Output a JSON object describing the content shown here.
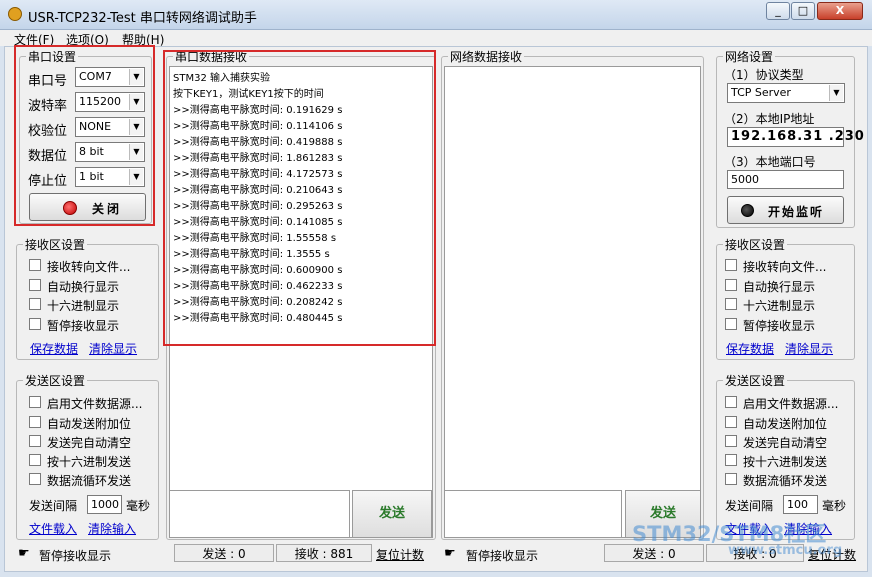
{
  "window": {
    "title": "USR-TCP232-Test 串口转网络调试助手",
    "min": "_",
    "max": "□",
    "close": "X"
  },
  "menu": [
    "文件(F)",
    "选项(O)",
    "帮助(H)"
  ],
  "serial_settings": {
    "title": "串口设置",
    "fields": [
      {
        "label": "串口号",
        "value": "COM7"
      },
      {
        "label": "波特率",
        "value": "115200"
      },
      {
        "label": "校验位",
        "value": "NONE"
      },
      {
        "label": "数据位",
        "value": "8 bit"
      },
      {
        "label": "停止位",
        "value": "1 bit"
      }
    ],
    "close_button": "关闭"
  },
  "serial_receive": {
    "title": "串口数据接收",
    "lines": [
      "STM32 输入捕获实验",
      "按下KEY1，测试KEY1按下的时间",
      ">>测得高电平脉宽时间: 0.191629 s",
      ">>测得高电平脉宽时间: 0.114106 s",
      ">>测得高电平脉宽时间: 0.419888 s",
      ">>测得高电平脉宽时间: 1.861283 s",
      ">>测得高电平脉宽时间: 4.172573 s",
      ">>测得高电平脉宽时间: 0.210643 s",
      ">>测得高电平脉宽时间: 0.295263 s",
      ">>测得高电平脉宽时间: 0.141085 s",
      ">>测得高电平脉宽时间: 1.55558 s",
      ">>测得高电平脉宽时间: 1.3555 s",
      ">>测得高电平脉宽时间: 0.600900 s",
      ">>测得高电平脉宽时间: 0.462233 s",
      ">>测得高电平脉宽时间: 0.208242 s",
      ">>测得高电平脉宽时间: 0.480445 s"
    ]
  },
  "network_receive": {
    "title": "网络数据接收"
  },
  "network_settings": {
    "title": "网络设置",
    "protocol_label": "（1）协议类型",
    "protocol_value": "TCP Server",
    "ip_label": "（2）本地IP地址",
    "ip_value": "192.168.31 .230",
    "port_label": "（3）本地端口号",
    "port_value": "5000",
    "listen_button": "开始监听"
  },
  "left_receive": {
    "title": "接收区设置",
    "options": [
      "接收转向文件...",
      "自动换行显示",
      "十六进制显示",
      "暂停接收显示"
    ],
    "save": "保存数据",
    "clear": "清除显示"
  },
  "left_send": {
    "title": "发送区设置",
    "options": [
      "启用文件数据源...",
      "自动发送附加位",
      "发送完自动清空",
      "按十六进制发送",
      "数据流循环发送"
    ],
    "interval_label": "发送间隔",
    "interval_value": "1000",
    "interval_unit": "毫秒",
    "load": "文件载入",
    "clear": "清除输入"
  },
  "right_receive": {
    "title": "接收区设置",
    "options": [
      "接收转向文件...",
      "自动换行显示",
      "十六进制显示",
      "暂停接收显示"
    ],
    "save": "保存数据",
    "clear": "清除显示"
  },
  "right_send": {
    "title": "发送区设置",
    "options": [
      "启用文件数据源...",
      "自动发送附加位",
      "发送完自动清空",
      "按十六进制发送",
      "数据流循环发送"
    ],
    "interval_label": "发送间隔",
    "interval_value": "100",
    "interval_unit": "毫秒",
    "load": "文件载入",
    "clear": "清除输入"
  },
  "send_button": "发送",
  "status_left": {
    "pause": "暂停接收显示",
    "send": "发送 : 0",
    "recv": "接收 : 881",
    "reset": "复位计数"
  },
  "status_right": {
    "pause": "暂停接收显示",
    "send": "发送 : 0",
    "recv": "接收 : 0",
    "reset": "复位计数"
  },
  "watermark": {
    "main": "STM32/STM8社区",
    "sub": "www.stmcu.org"
  },
  "colors": {
    "highlight_box": "#d62a2a",
    "send_green": "#2a7a2a",
    "link": "#0000cc"
  }
}
